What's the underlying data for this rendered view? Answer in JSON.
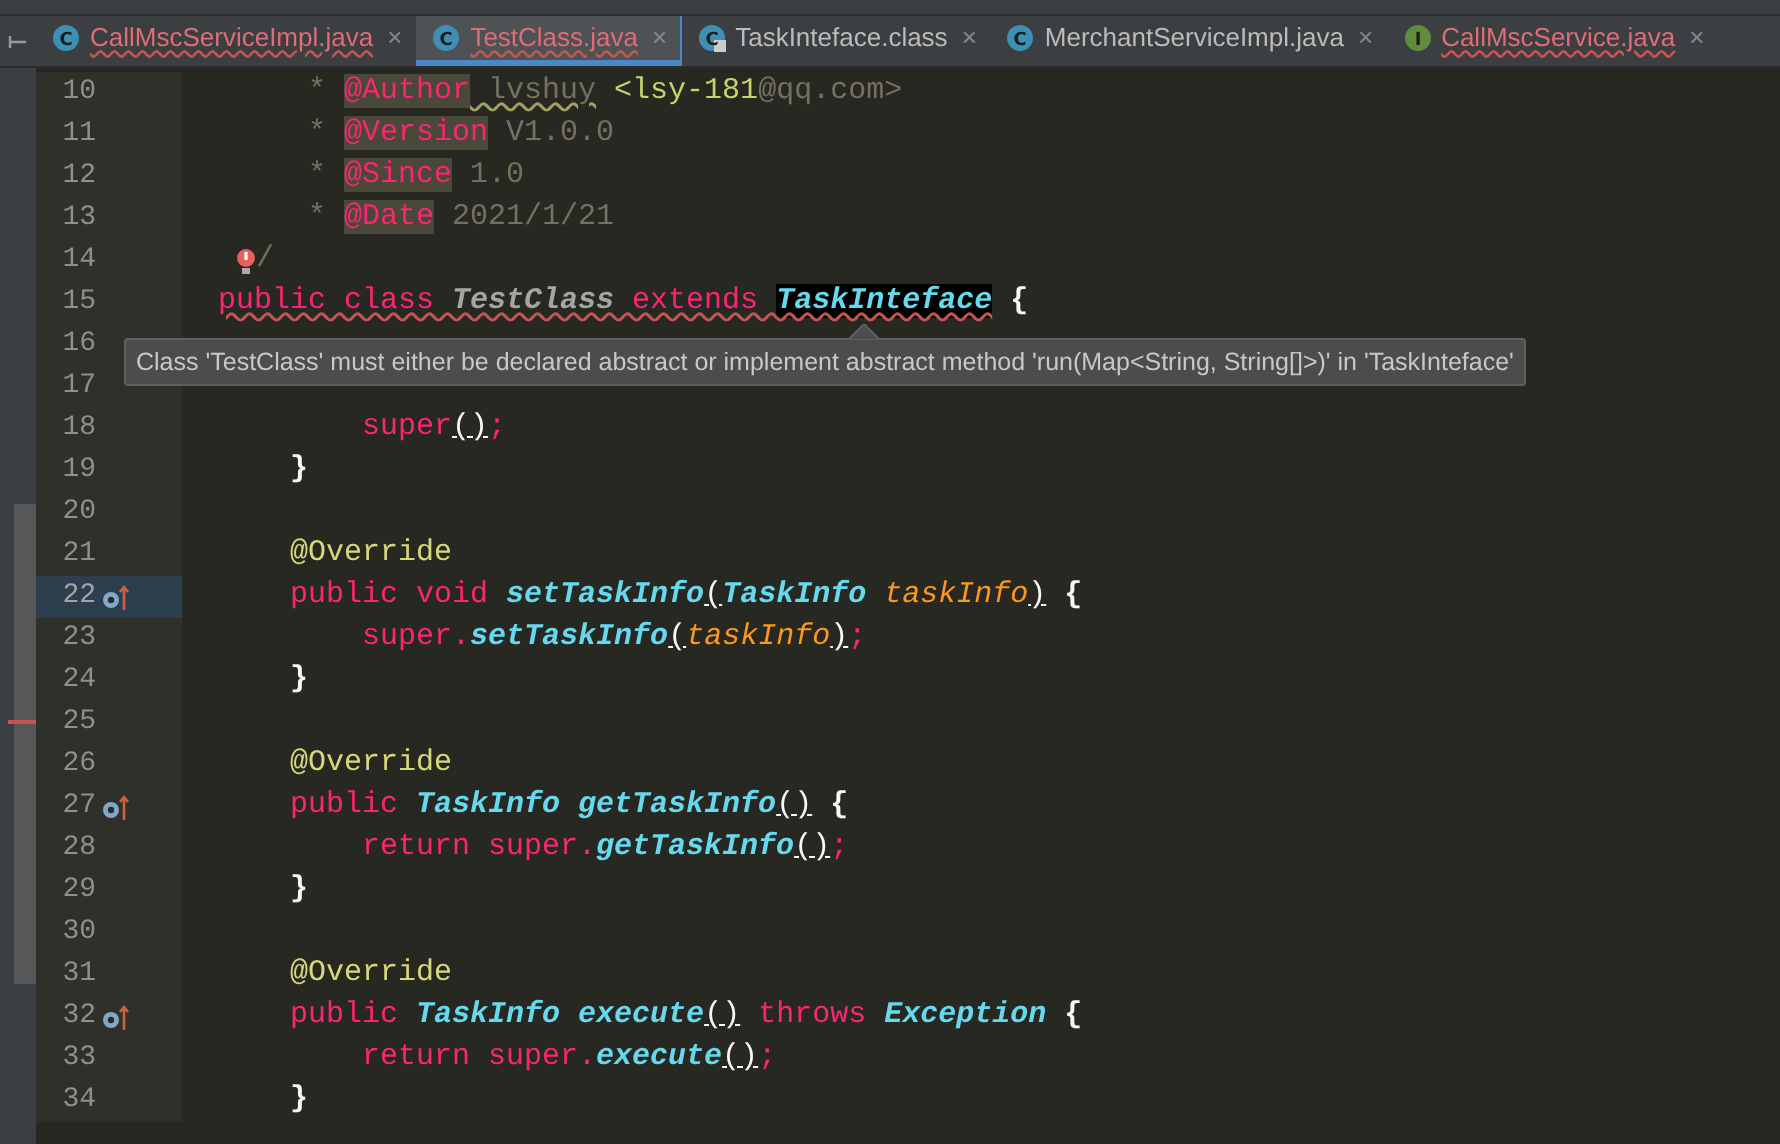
{
  "tabs": [
    {
      "label": "CallMscServiceImpl.java",
      "kind": "class",
      "icon_letter": "C",
      "error": true,
      "selected": false,
      "close": "×"
    },
    {
      "label": "TestClass.java",
      "kind": "class",
      "icon_letter": "C",
      "error": true,
      "selected": true,
      "close": "×"
    },
    {
      "label": "TaskInteface.class",
      "kind": "locked",
      "icon_letter": "C",
      "error": false,
      "selected": false,
      "close": "×"
    },
    {
      "label": "MerchantServiceImpl.java",
      "kind": "class",
      "icon_letter": "C",
      "error": false,
      "selected": false,
      "close": "×"
    },
    {
      "label": "CallMscService.java",
      "kind": "interface",
      "icon_letter": "I",
      "error": true,
      "selected": false,
      "close": "×"
    }
  ],
  "lines": [
    {
      "number": "10",
      "tokens": [
        {
          "text": "     * ",
          "kind": "comment"
        },
        {
          "text": "@Author",
          "kind": "tag"
        },
        {
          "text": " lvshuy",
          "kind": "typo"
        },
        {
          "text": " <lsy-181",
          "kind": "ref"
        },
        {
          "text": "@qq.com>",
          "kind": "comment"
        }
      ]
    },
    {
      "number": "11",
      "tokens": [
        {
          "text": "     * ",
          "kind": "comment"
        },
        {
          "text": "@Version",
          "kind": "tag"
        },
        {
          "text": " V1.0.0",
          "kind": "comment"
        }
      ]
    },
    {
      "number": "12",
      "tokens": [
        {
          "text": "     * ",
          "kind": "comment"
        },
        {
          "text": "@Since",
          "kind": "tag"
        },
        {
          "text": " 1.0",
          "kind": "comment"
        }
      ]
    },
    {
      "number": "13",
      "tokens": [
        {
          "text": "     * ",
          "kind": "comment"
        },
        {
          "text": "@Date",
          "kind": "tag"
        },
        {
          "text": " 2021/1/21",
          "kind": "comment"
        }
      ]
    },
    {
      "number": "14",
      "bulb": true,
      "tokens": [
        {
          "text": "/",
          "kind": "comment"
        }
      ]
    },
    {
      "number": "15",
      "tokens": [
        {
          "text": "public class ",
          "kind": "keyword",
          "error": true
        },
        {
          "text": "TestClass",
          "kind": "decl",
          "error": true
        },
        {
          "text": " extends ",
          "kind": "keyword",
          "error": true
        },
        {
          "text": "TaskInteface",
          "kind": "highlight",
          "error": true
        },
        {
          "text": " {",
          "kind": "brace"
        }
      ]
    },
    {
      "number": "16"
    },
    {
      "number": "17"
    },
    {
      "number": "18",
      "tokens": [
        {
          "text": "        super",
          "kind": "keyword"
        },
        {
          "text": "()",
          "kind": "paren"
        },
        {
          "text": ";",
          "kind": "keyword"
        }
      ]
    },
    {
      "number": "19",
      "tokens": [
        {
          "text": "    }",
          "kind": "brace"
        }
      ]
    },
    {
      "number": "20"
    },
    {
      "number": "21",
      "tokens": [
        {
          "text": "    @Override",
          "kind": "annotation"
        }
      ]
    },
    {
      "number": "22",
      "override": true,
      "current": true,
      "tokens": [
        {
          "text": "    public void ",
          "kind": "keyword"
        },
        {
          "text": "setTaskInfo",
          "kind": "method"
        },
        {
          "text": "(",
          "kind": "paren"
        },
        {
          "text": "TaskInfo ",
          "kind": "type"
        },
        {
          "text": "taskInfo",
          "kind": "param"
        },
        {
          "text": ")",
          "kind": "paren"
        },
        {
          "text": " {",
          "kind": "brace"
        }
      ]
    },
    {
      "number": "23",
      "tokens": [
        {
          "text": "        super.",
          "kind": "keyword"
        },
        {
          "text": "setTaskInfo",
          "kind": "method"
        },
        {
          "text": "(",
          "kind": "paren"
        },
        {
          "text": "taskInfo",
          "kind": "param"
        },
        {
          "text": ")",
          "kind": "paren"
        },
        {
          "text": ";",
          "kind": "keyword"
        }
      ]
    },
    {
      "number": "24",
      "tokens": [
        {
          "text": "    }",
          "kind": "brace"
        }
      ]
    },
    {
      "number": "25"
    },
    {
      "number": "26",
      "tokens": [
        {
          "text": "    @Override",
          "kind": "annotation"
        }
      ]
    },
    {
      "number": "27",
      "override": true,
      "tokens": [
        {
          "text": "    public ",
          "kind": "keyword"
        },
        {
          "text": "TaskInfo ",
          "kind": "type"
        },
        {
          "text": "getTaskInfo",
          "kind": "method"
        },
        {
          "text": "()",
          "kind": "paren"
        },
        {
          "text": " {",
          "kind": "brace"
        }
      ]
    },
    {
      "number": "28",
      "tokens": [
        {
          "text": "        return super.",
          "kind": "keyword"
        },
        {
          "text": "getTaskInfo",
          "kind": "method"
        },
        {
          "text": "()",
          "kind": "paren"
        },
        {
          "text": ";",
          "kind": "keyword"
        }
      ]
    },
    {
      "number": "29",
      "tokens": [
        {
          "text": "    }",
          "kind": "brace"
        }
      ]
    },
    {
      "number": "30"
    },
    {
      "number": "31",
      "tokens": [
        {
          "text": "    @Override",
          "kind": "annotation"
        }
      ]
    },
    {
      "number": "32",
      "override": true,
      "tokens": [
        {
          "text": "    public ",
          "kind": "keyword"
        },
        {
          "text": "TaskInfo ",
          "kind": "type"
        },
        {
          "text": "execute",
          "kind": "method"
        },
        {
          "text": "()",
          "kind": "paren"
        },
        {
          "text": " throws ",
          "kind": "keyword"
        },
        {
          "text": "Exception",
          "kind": "type"
        },
        {
          "text": " {",
          "kind": "brace"
        }
      ]
    },
    {
      "number": "33",
      "tokens": [
        {
          "text": "        return super.",
          "kind": "keyword"
        },
        {
          "text": "execute",
          "kind": "method"
        },
        {
          "text": "()",
          "kind": "paren"
        },
        {
          "text": ";",
          "kind": "keyword"
        }
      ]
    },
    {
      "number": "34",
      "tokens": [
        {
          "text": "    }",
          "kind": "brace"
        }
      ]
    }
  ],
  "tooltip": {
    "text": "Class 'TestClass' must either be declared abstract or implement abstract method 'run(Map<String, String[]>)' in 'TaskInteface'"
  }
}
